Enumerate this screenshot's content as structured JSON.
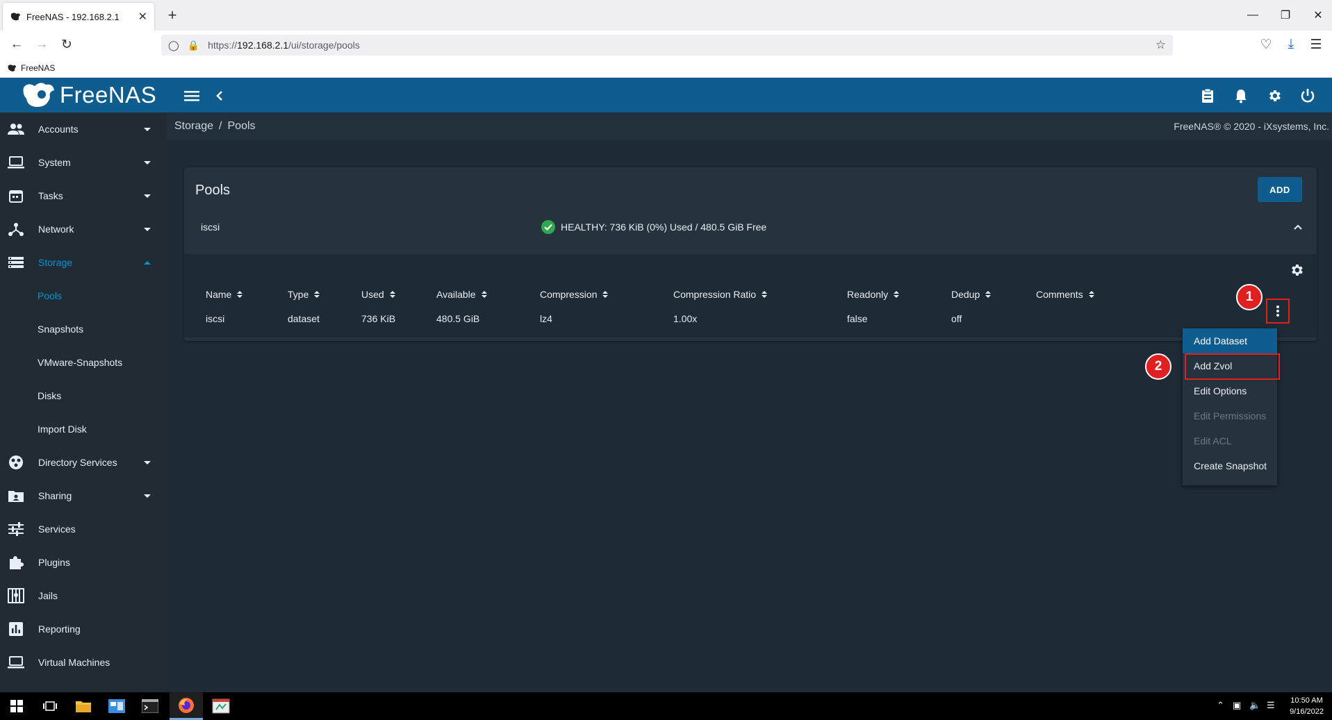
{
  "browser": {
    "tab_title": "FreeNAS - 192.168.2.1",
    "tab_close": "✕",
    "new_tab": "+",
    "url_prefix": "https://",
    "url_host": "192.168.2.1",
    "url_path": "/ui/storage/pools",
    "bookmark": "FreeNAS"
  },
  "app": {
    "logo_text": "FreeNAS",
    "breadcrumb_parent": "Storage",
    "breadcrumb_sep": "/",
    "breadcrumb_current": "Pools",
    "copyright": "FreeNAS® © 2020 - iXsystems, Inc."
  },
  "sidebar": {
    "items": [
      {
        "label": "Accounts"
      },
      {
        "label": "System"
      },
      {
        "label": "Tasks"
      },
      {
        "label": "Network"
      },
      {
        "label": "Storage"
      },
      {
        "label": "Directory Services"
      },
      {
        "label": "Sharing"
      },
      {
        "label": "Services"
      },
      {
        "label": "Plugins"
      },
      {
        "label": "Jails"
      },
      {
        "label": "Reporting"
      },
      {
        "label": "Virtual Machines"
      }
    ],
    "storage_sub": [
      "Pools",
      "Snapshots",
      "VMware-Snapshots",
      "Disks",
      "Import Disk"
    ]
  },
  "pools": {
    "title": "Pools",
    "add_label": "ADD",
    "pool_name": "iscsi",
    "health": "HEALTHY: 736 KiB (0%) Used / 480.5 GiB Free",
    "columns": [
      "Name",
      "Type",
      "Used",
      "Available",
      "Compression",
      "Compression Ratio",
      "Readonly",
      "Dedup",
      "Comments"
    ],
    "row": [
      "iscsi",
      "dataset",
      "736 KiB",
      "480.5 GiB",
      "lz4",
      "1.00x",
      "false",
      "off",
      ""
    ]
  },
  "menu": {
    "items": [
      "Add Dataset",
      "Add Zvol",
      "Edit Options",
      "Edit Permissions",
      "Edit ACL",
      "Create Snapshot"
    ]
  },
  "annotations": {
    "badge1": "1",
    "badge2": "2"
  },
  "taskbar": {
    "time": "10:50 AM",
    "date": "9/16/2022"
  },
  "colors": {
    "accent": "#0f5d8e",
    "active": "#0095d5",
    "healthy": "#2fa84f",
    "highlight_red": "#e02020"
  }
}
